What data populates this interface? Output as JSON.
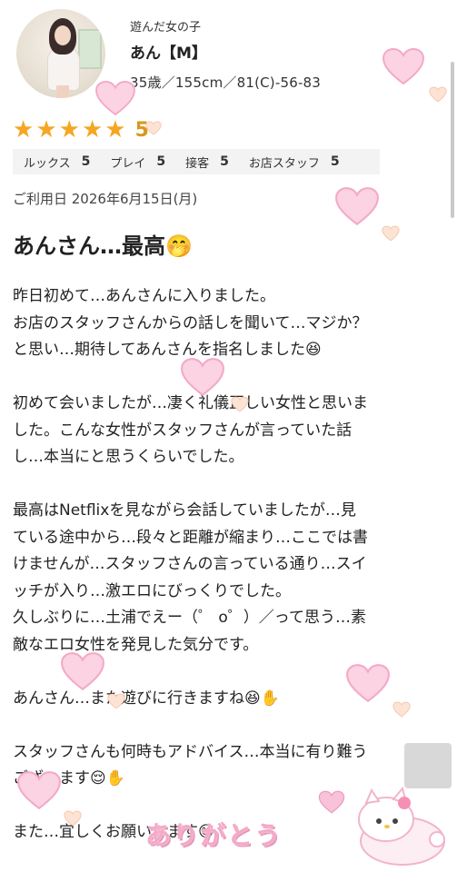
{
  "profile": {
    "label": "遊んだ女の子",
    "name": "あん【M】",
    "stats": "35歳／155cm／81(C)-56-83"
  },
  "rating": {
    "stars": 5,
    "score": "5"
  },
  "scores": [
    {
      "label": "ルックス",
      "value": "5"
    },
    {
      "label": "プレイ",
      "value": "5"
    },
    {
      "label": "接客",
      "value": "5"
    },
    {
      "label": "お店スタッフ",
      "value": "5"
    }
  ],
  "review": {
    "date": "ご利用日 2026年6月15日(月)",
    "title": "あんさん…最高🤭",
    "body": "昨日初めて…あんさんに入りました。\nお店のスタッフさんからの話しを聞いて…マジか？\nと思い…期待してあんさんを指名しました😆\n\n初めて会いましたが…凄く礼儀正しい女性と思いま\nした。こんな女性がスタッフさんが言っていた話\nし…本当にと思うくらいでした。\n\n最高はNetflixを見ながら会話していましたが…見\nている途中から…段々と距離が縮まり…ここでは書\nけませんが…スタッフさんの言っている通り…スイ\nッチが入り…激エロにびっくりでした。\n久しぶりに…土浦でえー（゜ o゜）／って思う…素\n敵なエロ女性を発見した気分です。\n\nあんさん…また遊びに行きますね😆✋\n\nスタッフさんも何時もアドバイス…本当に有り難う\nございます😌✋\n\nまた…宜しくお願いします😊"
  },
  "decoration": {
    "arigato": "ありがとう",
    "heart_color": "#f7b7d2"
  }
}
